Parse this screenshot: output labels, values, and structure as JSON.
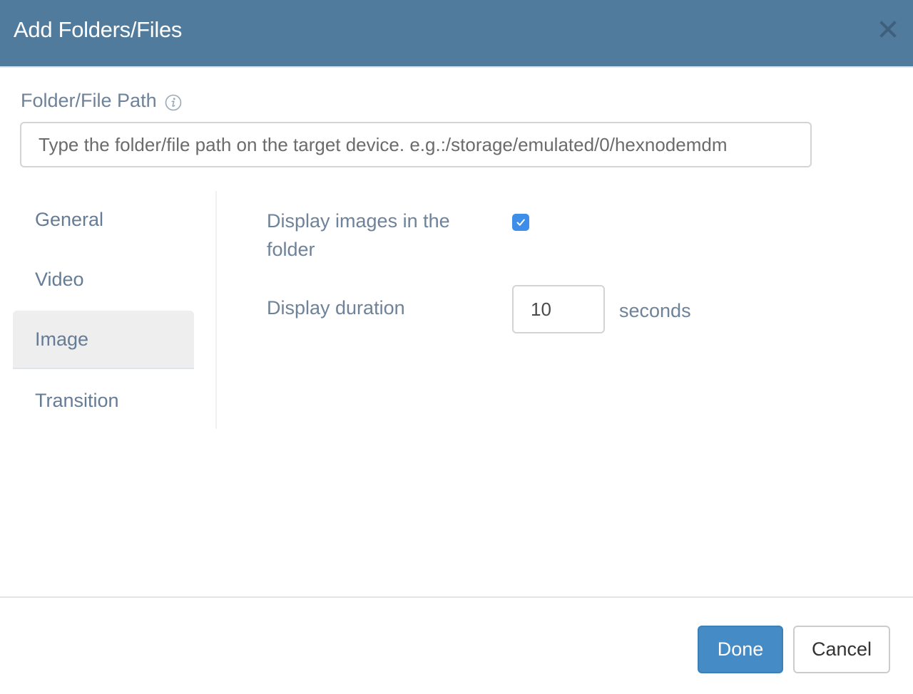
{
  "dialog": {
    "title": "Add Folders/Files",
    "close_icon": "close-icon"
  },
  "path_field": {
    "label": "Folder/File Path",
    "info_icon": "info-icon",
    "value": "",
    "placeholder": "Type the folder/file path on the target device. e.g.:/storage/emulated/0/hexnodemdm"
  },
  "tabs": [
    {
      "label": "General",
      "active": false
    },
    {
      "label": "Video",
      "active": false
    },
    {
      "label": "Image",
      "active": true
    },
    {
      "label": "Transition",
      "active": false
    }
  ],
  "image_settings": {
    "display_images_label": "Display images in the folder",
    "display_images_checked": true,
    "display_duration_label": "Display duration",
    "display_duration_value": "10",
    "display_duration_unit": "seconds"
  },
  "footer": {
    "done_label": "Done",
    "cancel_label": "Cancel"
  },
  "colors": {
    "header_bg": "#517b9c",
    "primary_button": "#458bc6",
    "checkbox": "#3d8ee8",
    "label_text": "#6e8299"
  }
}
